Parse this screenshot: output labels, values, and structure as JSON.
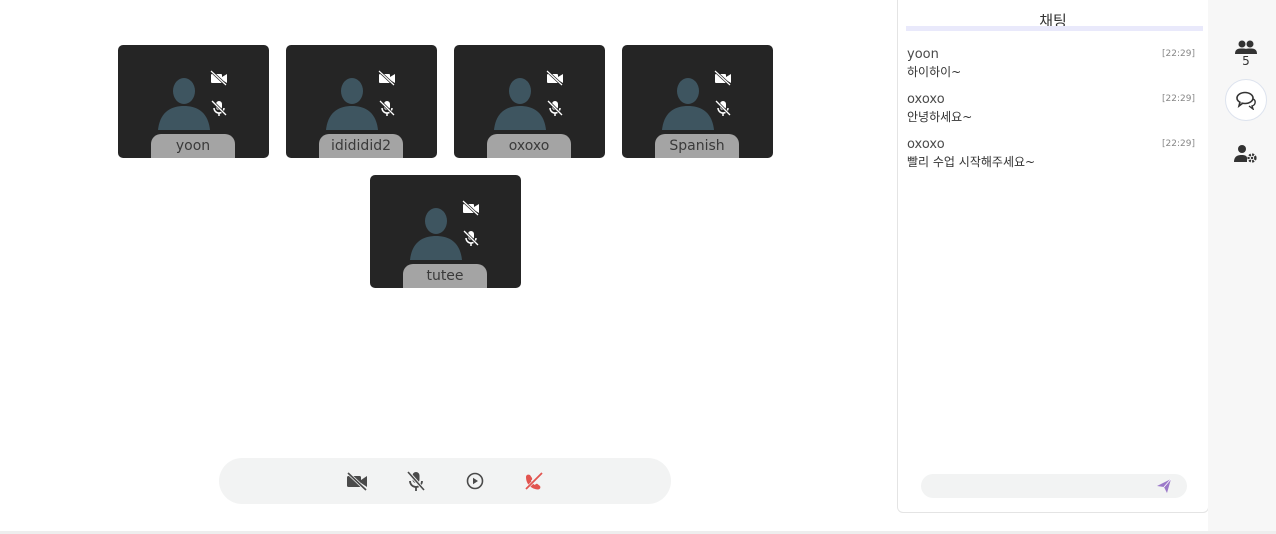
{
  "participants": [
    {
      "name": "yoon"
    },
    {
      "name": "idididid2"
    },
    {
      "name": "oxoxo"
    },
    {
      "name": "Spanish"
    },
    {
      "name": "tutee"
    }
  ],
  "controls": {
    "icons": [
      "video-off-icon",
      "mic-off-icon",
      "play-circle-icon",
      "hang-up-icon"
    ],
    "hangup_color": "#e2544f"
  },
  "chat": {
    "title": "채팅",
    "messages": [
      {
        "sender": "yoon",
        "time": "[22:29]",
        "text": "하이하이~"
      },
      {
        "sender": "oxoxo",
        "time": "[22:29]",
        "text": "안녕하세요~"
      },
      {
        "sender": "oxoxo",
        "time": "[22:29]",
        "text": "빨리 수업 시작해주세요~"
      }
    ],
    "input_value": "",
    "send_color": "#9b78c9"
  },
  "sidebar": {
    "participant_count": "5",
    "icons": [
      "participants-icon",
      "chat-icon",
      "user-settings-icon"
    ]
  },
  "colors": {
    "tile_bg": "#252525",
    "avatar": "#3e5560",
    "name_tag": "#a4a4a4",
    "accent_bar": "#e9e9fb"
  }
}
